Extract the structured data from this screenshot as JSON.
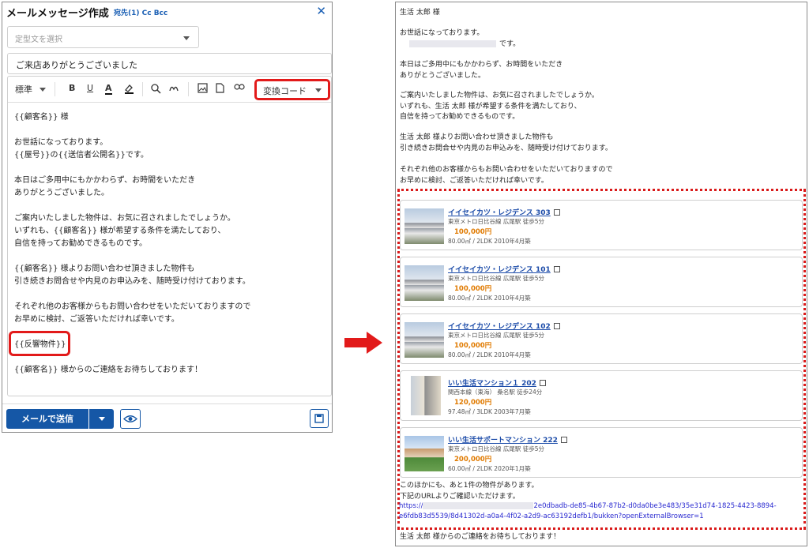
{
  "composer": {
    "title": "メールメッセージ作成",
    "recipients": "宛先(1) Cc Bcc",
    "close": "✕",
    "template_placeholder": "定型文を選択",
    "subject": "ご来店ありがとうございました",
    "toolbar": {
      "format": "標準",
      "bold": "B",
      "underline": "U",
      "text_color": "A",
      "convert_code": "変換コード"
    },
    "body": [
      [
        "{{顧客名}} 様"
      ],
      [
        "お世話になっております。",
        "{{屋号}}の{{送信者公開名}}です。"
      ],
      [
        "本日はご多用中にもかかわらず、お時間をいただき",
        "ありがとうございました。"
      ],
      [
        "ご案内いたしました物件は、お気に召されましたでしょうか。",
        "いずれも、{{顧客名}} 様が希望する条件を満たしており、",
        "自信を持ってお勧めできるものです。"
      ],
      [
        "{{顧客名}} 様よりお問い合わせ頂きました物件も",
        "引き続きお問合せや内見のお申込みを、随時受け付けております。"
      ],
      [
        "それぞれ他のお客様からもお問い合わせをいただいておりますので",
        "お早めに検討、ご返答いただければ幸いです。"
      ],
      [
        "{{反響物件}}"
      ],
      [
        "{{顧客名}} 様からのご連絡をお待ちしております！"
      ]
    ],
    "send_label": "メールで送信"
  },
  "preview": {
    "greeting": "生活 太郎 様",
    "intro": [
      "お世話になっております。",
      "です。"
    ],
    "para1": [
      "本日はご多用中にもかかわらず、お時間をいただき",
      "ありがとうございました。"
    ],
    "para2": [
      "ご案内いたしました物件は、お気に召されましたでしょうか。",
      "いずれも、生活 太郎 様が希望する条件を満たしており、",
      "自信を持ってお勧めできるものです。"
    ],
    "para3": [
      "生活 太郎 様よりお問い合わせ頂きました物件も",
      "引き続きお問合せや内見のお申込みを、随時受け付けております。"
    ],
    "para4": [
      "それぞれ他のお客様からもお問い合わせをいただいておりますので",
      "お早めに検討、ご返答いただければ幸いです。"
    ],
    "properties": [
      {
        "name": "イイセイカツ・レジデンス 303",
        "station": "東京メトロ日比谷線 広尾駅 徒歩5分",
        "price": "100,000円",
        "spec": "80.00㎡ / 2LDK  2010年4月築"
      },
      {
        "name": "イイセイカツ・レジデンス 101",
        "station": "東京メトロ日比谷線 広尾駅 徒歩5分",
        "price": "100,000円",
        "spec": "80.00㎡ / 2LDK  2010年4月築"
      },
      {
        "name": "イイセイカツ・レジデンス 102",
        "station": "東京メトロ日比谷線 広尾駅 徒歩5分",
        "price": "100,000円",
        "spec": "80.00㎡ / 2LDK  2010年4月築"
      },
      {
        "name": "いい生活マンション１ 202",
        "station": "関西本線（東海） 桑名駅 徒歩24分",
        "price": "120,000円",
        "spec": "97.48㎡ / 3LDK  2003年7月築"
      },
      {
        "name": "いい生活サポートマンション 222",
        "station": "東京メトロ日比谷線 広尾駅 徒歩5分",
        "price": "200,000円",
        "spec": "60.00㎡ / 2LDK  2020年1月築"
      }
    ],
    "footer_lines": [
      "このほかにも、あと1件の物件があります。",
      "下記のURLよりご確認いただけます。"
    ],
    "url_line1_start": "https://",
    "url_line1_end": "2e0dbadb-de85-4b67-87b2-d0da0be3e483/35e31d74-1825-4423-8894-",
    "url_line2": "e6fdb83d5539/8d41302d-a0a4-4f02-a2d9-ac63192defb1/bukken?openExternalBrowser=1",
    "closing": "生活 太郎 様からのご連絡をお待ちしております！"
  },
  "colors": {
    "accent_blue": "#1557a6",
    "highlight_red": "#e21a1a",
    "price_orange": "#e07a00",
    "link_blue": "#1a4aa8"
  }
}
